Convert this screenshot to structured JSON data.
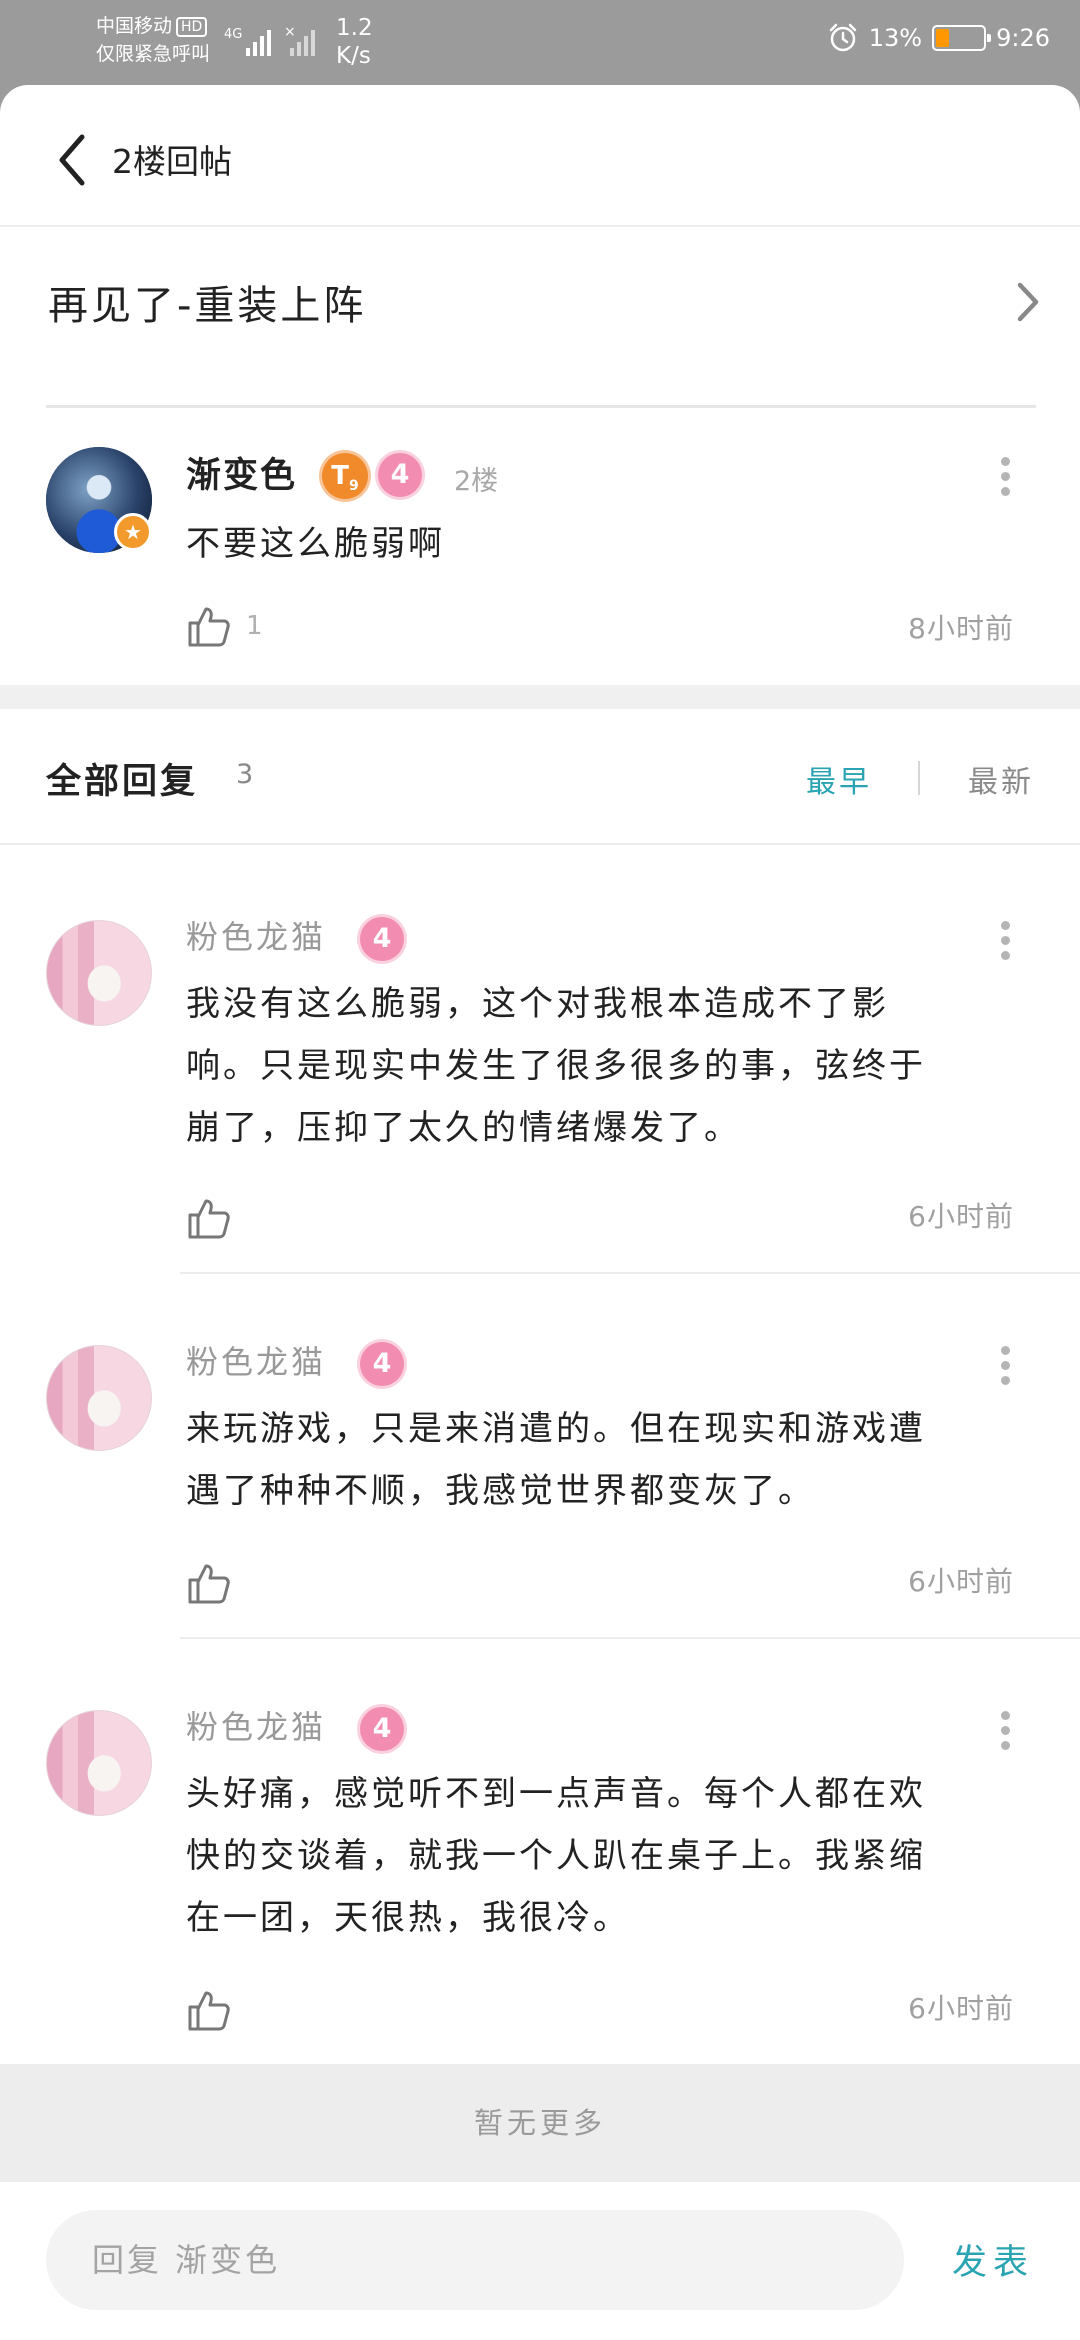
{
  "status_bar": {
    "carrier_line1": "中国移动",
    "carrier_hd": "HD",
    "carrier_line2": "仅限紧急呼叫",
    "network": "4G",
    "speed_value": "1.2",
    "speed_unit": "K/s",
    "battery": "13%",
    "time": "9:26"
  },
  "header": {
    "title": "2楼回帖",
    "post_title": "再见了-重装上阵"
  },
  "main_comment": {
    "user": "渐变色",
    "title_badge": "T",
    "title_badge_sub": "9",
    "level": "4",
    "floor": "2楼",
    "text": "不要这么脆弱啊",
    "likes": "1",
    "time": "8小时前"
  },
  "replies_section": {
    "title": "全部回复",
    "count": "3",
    "sort_earliest": "最早",
    "sort_newest": "最新"
  },
  "replies": [
    {
      "user": "粉色龙猫",
      "level": "4",
      "line1": "我没有这么脆弱，这个对我根本造成不了影",
      "line2": "响。只是现实中发生了很多很多的事，弦终于",
      "line3": "崩了，压抑了太久的情绪爆发了。",
      "time": "6小时前"
    },
    {
      "user": "粉色龙猫",
      "level": "4",
      "line1": "来玩游戏，只是来消遣的。但在现实和游戏遭",
      "line2": "遇了种种不顺，我感觉世界都变灰了。",
      "time": "6小时前"
    },
    {
      "user": "粉色龙猫",
      "level": "4",
      "line1": "头好痛，感觉听不到一点声音。每个人都在欢",
      "line2": "快的交谈着，就我一个人趴在桌子上。我紧缩",
      "line3": "在一团，天很热，我很冷。",
      "time": "6小时前"
    }
  ],
  "footer": {
    "no_more": "暂无更多",
    "reply_placeholder": "回复 渐变色",
    "send": "发表"
  },
  "colors": {
    "accent": "#2aa4b3",
    "level_badge": "#f28cb0",
    "title_badge": "#f08a2a"
  }
}
